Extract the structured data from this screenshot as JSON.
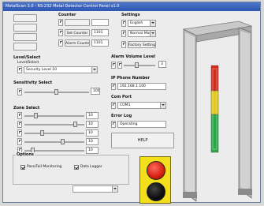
{
  "window": {
    "title": "MetalScan 3.0 - RS-232 Metal Detector Control Panel v1.0"
  },
  "controls": {
    "btn1": "",
    "btn2": "",
    "btn3": "",
    "btn4": ""
  },
  "counter": {
    "title": "Counter",
    "rows": [
      {
        "label": "",
        "value": ""
      },
      {
        "label": "Set Counter",
        "value": "1101"
      },
      {
        "label": "Alarm Counter",
        "value": "1101"
      }
    ]
  },
  "settings": {
    "title": "Settings",
    "language": "English",
    "mode": "Normal Mode",
    "factory_button": "Factory Settings"
  },
  "level": {
    "title": "Level/Select",
    "subtitle": "Level/Select",
    "selected": "Security Level 10"
  },
  "sensitivity": {
    "title": "Sensitivity Select",
    "value": "100"
  },
  "zone": {
    "title": "Zone Select",
    "values": [
      "10",
      "10",
      "10",
      "10",
      "10",
      "10"
    ]
  },
  "alarm": {
    "title": "Alarm Volume Level",
    "value": "3"
  },
  "ip": {
    "title": "IP Phone Number",
    "value": "192.168.1.100"
  },
  "com": {
    "title": "Com Port",
    "value": "COM1"
  },
  "error": {
    "title": "Error Log",
    "value": "Operating"
  },
  "help_button": "HELP",
  "options": {
    "title": "Options",
    "check1": "Pass/Fail Monitoring",
    "check2": "Data Logger",
    "dropdown": ""
  },
  "status_colors": {
    "red": "#d41f12",
    "black": "#0d0d0d",
    "panel": "#f3df1c"
  }
}
